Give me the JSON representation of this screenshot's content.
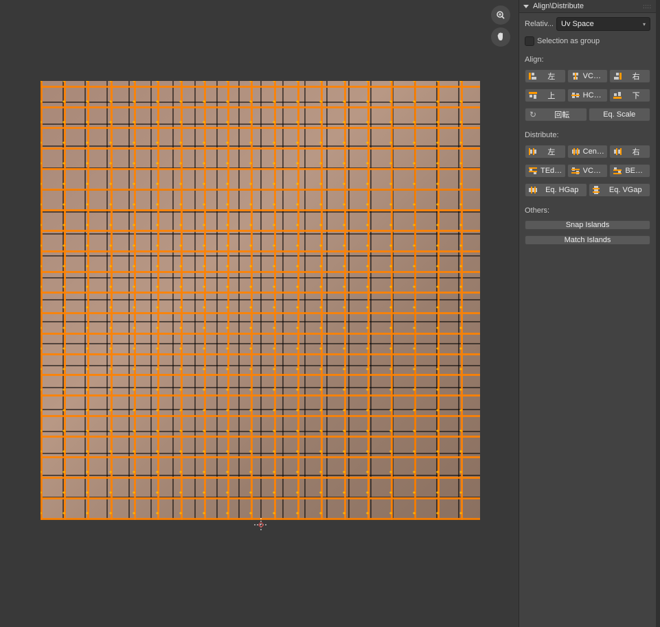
{
  "panel": {
    "title": "Align\\Distribute",
    "relative_to_label": "Relativ...",
    "relative_to_value": "Uv Space",
    "selection_as_group_label": "Selection as group",
    "align_label": "Align:",
    "align_buttons": {
      "left": "左",
      "vcenter": "VCen...",
      "right": "右",
      "top": "上",
      "hcenter": "HCen...",
      "bottom": "下",
      "rotation": "回転",
      "eq_scale": "Eq. Scale"
    },
    "distribute_label": "Distribute:",
    "distribute_buttons": {
      "left": "左",
      "center": "Center",
      "right": "右",
      "tedges": "TEdges",
      "vcen": "VCen...",
      "bedges": "BEdges",
      "eq_hgap": "Eq. HGap",
      "eq_vgap": "Eq. VGap"
    },
    "others_label": "Others:",
    "others_buttons": {
      "snap_islands": "Snap Islands",
      "match_islands": "Match Islands"
    }
  },
  "viewport": {
    "zoom_icon": "zoom",
    "pan_icon": "pan"
  }
}
